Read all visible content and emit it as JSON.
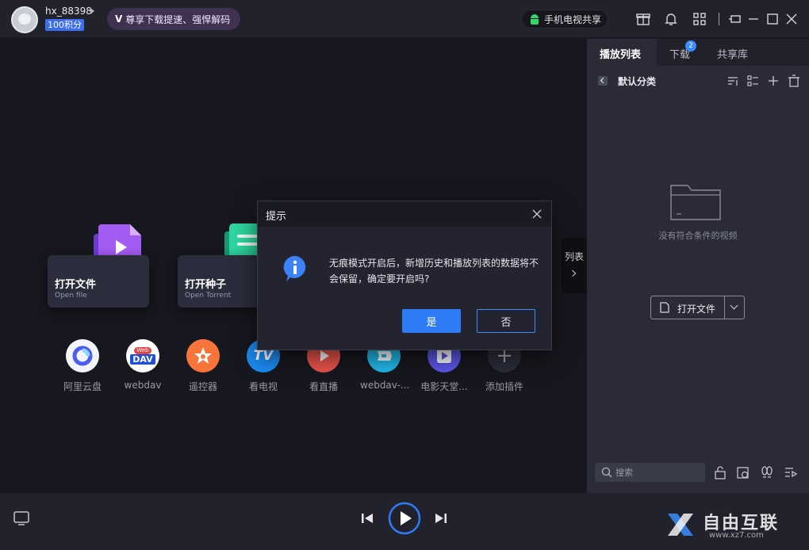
{
  "user": {
    "name": "hx_88398",
    "points": "100积分"
  },
  "vip_banner": {
    "badge": "V",
    "text": "尊享下载提速、强悍解码"
  },
  "tv_share": {
    "label": "手机电视共享"
  },
  "main": {
    "cards": [
      {
        "title": "打开文件",
        "subtitle": "Open file"
      },
      {
        "title": "打开种子",
        "subtitle": "Open Torrent"
      }
    ],
    "plugins": [
      {
        "label": "阿里云盘",
        "icon": "aliyun-icon"
      },
      {
        "label": "webdav",
        "icon": "webdav-icon",
        "glyph": "DAV",
        "glyph_top": "Web"
      },
      {
        "label": "遥控器",
        "icon": "remote-star-icon"
      },
      {
        "label": "看电视",
        "icon": "tv-icon",
        "glyph": "TV"
      },
      {
        "label": "看直播",
        "icon": "live-play-icon"
      },
      {
        "label": "webdav-...",
        "icon": "webdav-plugin-icon"
      },
      {
        "label": "电影天堂...",
        "icon": "movie-heaven-icon"
      },
      {
        "label": "添加插件",
        "icon": "add-plugin-icon",
        "glyph": "+"
      }
    ],
    "side_tab": {
      "label": "列表"
    }
  },
  "right_panel": {
    "tabs": [
      {
        "label": "播放列表",
        "active": true
      },
      {
        "label": "下载",
        "badge": "2"
      },
      {
        "label": "共享库"
      }
    ],
    "category": "默认分类",
    "empty_text": "没有符合条件的视频",
    "open_button": "打开文件",
    "search_placeholder": "搜索"
  },
  "dialog": {
    "title": "提示",
    "message": "无痕模式开启后，新增历史和播放列表的数据将不会保留，确定要开启吗?",
    "yes": "是",
    "no": "否"
  },
  "watermark": {
    "text": "自由互联",
    "sub": "www.xz7.com"
  },
  "colors": {
    "accent": "#2f7bf5",
    "panel": "#2a2b37",
    "background": "#17171f"
  }
}
